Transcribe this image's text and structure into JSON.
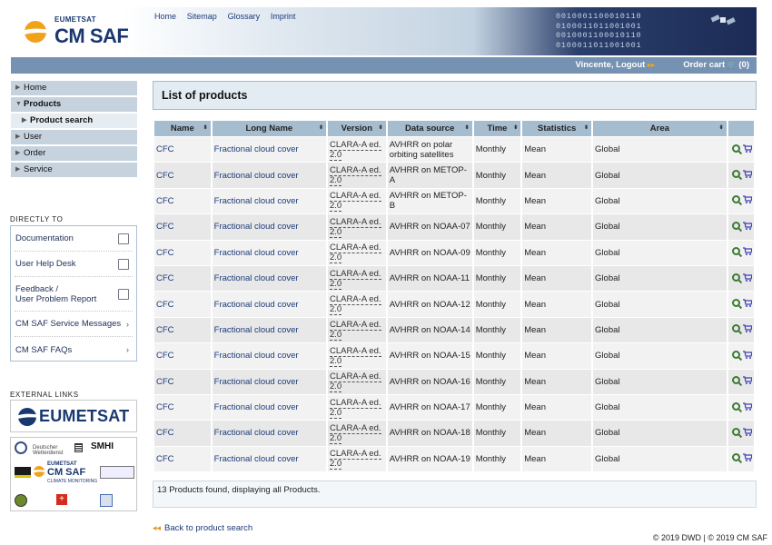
{
  "header": {
    "logo_top": "EUMETSAT",
    "logo_main": "CM SAF",
    "topnav": [
      "Home",
      "Sitemap",
      "Glossary",
      "Imprint"
    ],
    "binary": [
      "0010001100010110",
      "0100011011001001",
      "0010001100010110",
      "0100011011001001"
    ]
  },
  "userbar": {
    "user": "Vincente, Logout",
    "cart": "Order cart",
    "cart_count": "(0)"
  },
  "sidebar": {
    "nav": [
      "Home",
      "Products",
      "Product search",
      "User",
      "Order",
      "Service"
    ],
    "directly_to_heading": "DIRECTLY TO",
    "directly_to": [
      "Documentation",
      "User Help Desk",
      "Feedback /",
      "User Problem Report",
      "CM SAF Service Messages",
      "CM SAF FAQs"
    ],
    "external_heading": "EXTERNAL LINKS",
    "eumetsat_logo": "EUMETSAT",
    "partners": [
      "Deutscher Wetterdienst",
      "SMHI",
      "EUMETSAT",
      "CM SAF",
      "CLIMATE MONITORING"
    ]
  },
  "main": {
    "title": "List of products",
    "columns": [
      "Name",
      "Long Name",
      "Version",
      "Data source",
      "Time",
      "Statistics",
      "Area"
    ],
    "rows": [
      {
        "name": "CFC",
        "long": "Fractional cloud cover",
        "ver": "CLARA-A ed. 2.0",
        "src": "AVHRR on polar orbiting satellites",
        "time": "Monthly",
        "stat": "Mean",
        "area": "Global"
      },
      {
        "name": "CFC",
        "long": "Fractional cloud cover",
        "ver": "CLARA-A ed. 2.0",
        "src": "AVHRR on METOP-A",
        "time": "Monthly",
        "stat": "Mean",
        "area": "Global"
      },
      {
        "name": "CFC",
        "long": "Fractional cloud cover",
        "ver": "CLARA-A ed. 2.0",
        "src": "AVHRR on METOP-B",
        "time": "Monthly",
        "stat": "Mean",
        "area": "Global"
      },
      {
        "name": "CFC",
        "long": "Fractional cloud cover",
        "ver": "CLARA-A ed. 2.0",
        "src": "AVHRR on NOAA-07",
        "time": "Monthly",
        "stat": "Mean",
        "area": "Global"
      },
      {
        "name": "CFC",
        "long": "Fractional cloud cover",
        "ver": "CLARA-A ed. 2.0",
        "src": "AVHRR on NOAA-09",
        "time": "Monthly",
        "stat": "Mean",
        "area": "Global"
      },
      {
        "name": "CFC",
        "long": "Fractional cloud cover",
        "ver": "CLARA-A ed. 2.0",
        "src": "AVHRR on NOAA-11",
        "time": "Monthly",
        "stat": "Mean",
        "area": "Global"
      },
      {
        "name": "CFC",
        "long": "Fractional cloud cover",
        "ver": "CLARA-A ed. 2.0",
        "src": "AVHRR on NOAA-12",
        "time": "Monthly",
        "stat": "Mean",
        "area": "Global"
      },
      {
        "name": "CFC",
        "long": "Fractional cloud cover",
        "ver": "CLARA-A ed. 2.0",
        "src": "AVHRR on NOAA-14",
        "time": "Monthly",
        "stat": "Mean",
        "area": "Global"
      },
      {
        "name": "CFC",
        "long": "Fractional cloud cover",
        "ver": "CLARA-A ed. 2.0",
        "src": "AVHRR on NOAA-15",
        "time": "Monthly",
        "stat": "Mean",
        "area": "Global"
      },
      {
        "name": "CFC",
        "long": "Fractional cloud cover",
        "ver": "CLARA-A ed. 2.0",
        "src": "AVHRR on NOAA-16",
        "time": "Monthly",
        "stat": "Mean",
        "area": "Global"
      },
      {
        "name": "CFC",
        "long": "Fractional cloud cover",
        "ver": "CLARA-A ed. 2.0",
        "src": "AVHRR on NOAA-17",
        "time": "Monthly",
        "stat": "Mean",
        "area": "Global"
      },
      {
        "name": "CFC",
        "long": "Fractional cloud cover",
        "ver": "CLARA-A ed. 2.0",
        "src": "AVHRR on NOAA-18",
        "time": "Monthly",
        "stat": "Mean",
        "area": "Global"
      },
      {
        "name": "CFC",
        "long": "Fractional cloud cover",
        "ver": "CLARA-A ed. 2.0",
        "src": "AVHRR on NOAA-19",
        "time": "Monthly",
        "stat": "Mean",
        "area": "Global"
      }
    ],
    "found": "13 Products found, displaying all Products.",
    "back": "Back to product search"
  },
  "footer": "© 2019 DWD | © 2019 CM SAF",
  "colors": {
    "brand": "#1a3870",
    "accent": "#f0a21b",
    "nav_bg": "#c6d3df",
    "table_header": "#a6bccf"
  }
}
